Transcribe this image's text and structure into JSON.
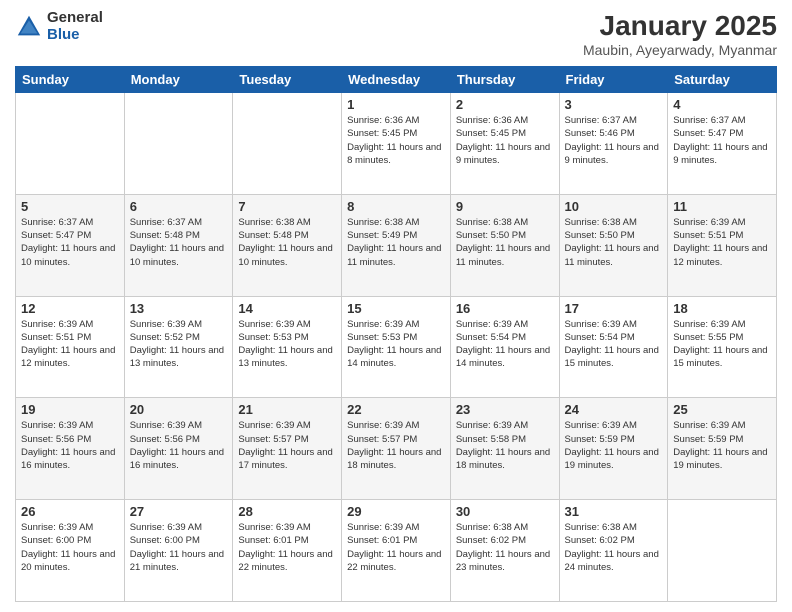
{
  "header": {
    "logo_general": "General",
    "logo_blue": "Blue",
    "title": "January 2025",
    "subtitle": "Maubin, Ayeyarwady, Myanmar"
  },
  "weekdays": [
    "Sunday",
    "Monday",
    "Tuesday",
    "Wednesday",
    "Thursday",
    "Friday",
    "Saturday"
  ],
  "weeks": [
    [
      {
        "day": "",
        "sunrise": "",
        "sunset": "",
        "daylight": ""
      },
      {
        "day": "",
        "sunrise": "",
        "sunset": "",
        "daylight": ""
      },
      {
        "day": "",
        "sunrise": "",
        "sunset": "",
        "daylight": ""
      },
      {
        "day": "1",
        "sunrise": "Sunrise: 6:36 AM",
        "sunset": "Sunset: 5:45 PM",
        "daylight": "Daylight: 11 hours and 8 minutes."
      },
      {
        "day": "2",
        "sunrise": "Sunrise: 6:36 AM",
        "sunset": "Sunset: 5:45 PM",
        "daylight": "Daylight: 11 hours and 9 minutes."
      },
      {
        "day": "3",
        "sunrise": "Sunrise: 6:37 AM",
        "sunset": "Sunset: 5:46 PM",
        "daylight": "Daylight: 11 hours and 9 minutes."
      },
      {
        "day": "4",
        "sunrise": "Sunrise: 6:37 AM",
        "sunset": "Sunset: 5:47 PM",
        "daylight": "Daylight: 11 hours and 9 minutes."
      }
    ],
    [
      {
        "day": "5",
        "sunrise": "Sunrise: 6:37 AM",
        "sunset": "Sunset: 5:47 PM",
        "daylight": "Daylight: 11 hours and 10 minutes."
      },
      {
        "day": "6",
        "sunrise": "Sunrise: 6:37 AM",
        "sunset": "Sunset: 5:48 PM",
        "daylight": "Daylight: 11 hours and 10 minutes."
      },
      {
        "day": "7",
        "sunrise": "Sunrise: 6:38 AM",
        "sunset": "Sunset: 5:48 PM",
        "daylight": "Daylight: 11 hours and 10 minutes."
      },
      {
        "day": "8",
        "sunrise": "Sunrise: 6:38 AM",
        "sunset": "Sunset: 5:49 PM",
        "daylight": "Daylight: 11 hours and 11 minutes."
      },
      {
        "day": "9",
        "sunrise": "Sunrise: 6:38 AM",
        "sunset": "Sunset: 5:50 PM",
        "daylight": "Daylight: 11 hours and 11 minutes."
      },
      {
        "day": "10",
        "sunrise": "Sunrise: 6:38 AM",
        "sunset": "Sunset: 5:50 PM",
        "daylight": "Daylight: 11 hours and 11 minutes."
      },
      {
        "day": "11",
        "sunrise": "Sunrise: 6:39 AM",
        "sunset": "Sunset: 5:51 PM",
        "daylight": "Daylight: 11 hours and 12 minutes."
      }
    ],
    [
      {
        "day": "12",
        "sunrise": "Sunrise: 6:39 AM",
        "sunset": "Sunset: 5:51 PM",
        "daylight": "Daylight: 11 hours and 12 minutes."
      },
      {
        "day": "13",
        "sunrise": "Sunrise: 6:39 AM",
        "sunset": "Sunset: 5:52 PM",
        "daylight": "Daylight: 11 hours and 13 minutes."
      },
      {
        "day": "14",
        "sunrise": "Sunrise: 6:39 AM",
        "sunset": "Sunset: 5:53 PM",
        "daylight": "Daylight: 11 hours and 13 minutes."
      },
      {
        "day": "15",
        "sunrise": "Sunrise: 6:39 AM",
        "sunset": "Sunset: 5:53 PM",
        "daylight": "Daylight: 11 hours and 14 minutes."
      },
      {
        "day": "16",
        "sunrise": "Sunrise: 6:39 AM",
        "sunset": "Sunset: 5:54 PM",
        "daylight": "Daylight: 11 hours and 14 minutes."
      },
      {
        "day": "17",
        "sunrise": "Sunrise: 6:39 AM",
        "sunset": "Sunset: 5:54 PM",
        "daylight": "Daylight: 11 hours and 15 minutes."
      },
      {
        "day": "18",
        "sunrise": "Sunrise: 6:39 AM",
        "sunset": "Sunset: 5:55 PM",
        "daylight": "Daylight: 11 hours and 15 minutes."
      }
    ],
    [
      {
        "day": "19",
        "sunrise": "Sunrise: 6:39 AM",
        "sunset": "Sunset: 5:56 PM",
        "daylight": "Daylight: 11 hours and 16 minutes."
      },
      {
        "day": "20",
        "sunrise": "Sunrise: 6:39 AM",
        "sunset": "Sunset: 5:56 PM",
        "daylight": "Daylight: 11 hours and 16 minutes."
      },
      {
        "day": "21",
        "sunrise": "Sunrise: 6:39 AM",
        "sunset": "Sunset: 5:57 PM",
        "daylight": "Daylight: 11 hours and 17 minutes."
      },
      {
        "day": "22",
        "sunrise": "Sunrise: 6:39 AM",
        "sunset": "Sunset: 5:57 PM",
        "daylight": "Daylight: 11 hours and 18 minutes."
      },
      {
        "day": "23",
        "sunrise": "Sunrise: 6:39 AM",
        "sunset": "Sunset: 5:58 PM",
        "daylight": "Daylight: 11 hours and 18 minutes."
      },
      {
        "day": "24",
        "sunrise": "Sunrise: 6:39 AM",
        "sunset": "Sunset: 5:59 PM",
        "daylight": "Daylight: 11 hours and 19 minutes."
      },
      {
        "day": "25",
        "sunrise": "Sunrise: 6:39 AM",
        "sunset": "Sunset: 5:59 PM",
        "daylight": "Daylight: 11 hours and 19 minutes."
      }
    ],
    [
      {
        "day": "26",
        "sunrise": "Sunrise: 6:39 AM",
        "sunset": "Sunset: 6:00 PM",
        "daylight": "Daylight: 11 hours and 20 minutes."
      },
      {
        "day": "27",
        "sunrise": "Sunrise: 6:39 AM",
        "sunset": "Sunset: 6:00 PM",
        "daylight": "Daylight: 11 hours and 21 minutes."
      },
      {
        "day": "28",
        "sunrise": "Sunrise: 6:39 AM",
        "sunset": "Sunset: 6:01 PM",
        "daylight": "Daylight: 11 hours and 22 minutes."
      },
      {
        "day": "29",
        "sunrise": "Sunrise: 6:39 AM",
        "sunset": "Sunset: 6:01 PM",
        "daylight": "Daylight: 11 hours and 22 minutes."
      },
      {
        "day": "30",
        "sunrise": "Sunrise: 6:38 AM",
        "sunset": "Sunset: 6:02 PM",
        "daylight": "Daylight: 11 hours and 23 minutes."
      },
      {
        "day": "31",
        "sunrise": "Sunrise: 6:38 AM",
        "sunset": "Sunset: 6:02 PM",
        "daylight": "Daylight: 11 hours and 24 minutes."
      },
      {
        "day": "",
        "sunrise": "",
        "sunset": "",
        "daylight": ""
      }
    ]
  ]
}
